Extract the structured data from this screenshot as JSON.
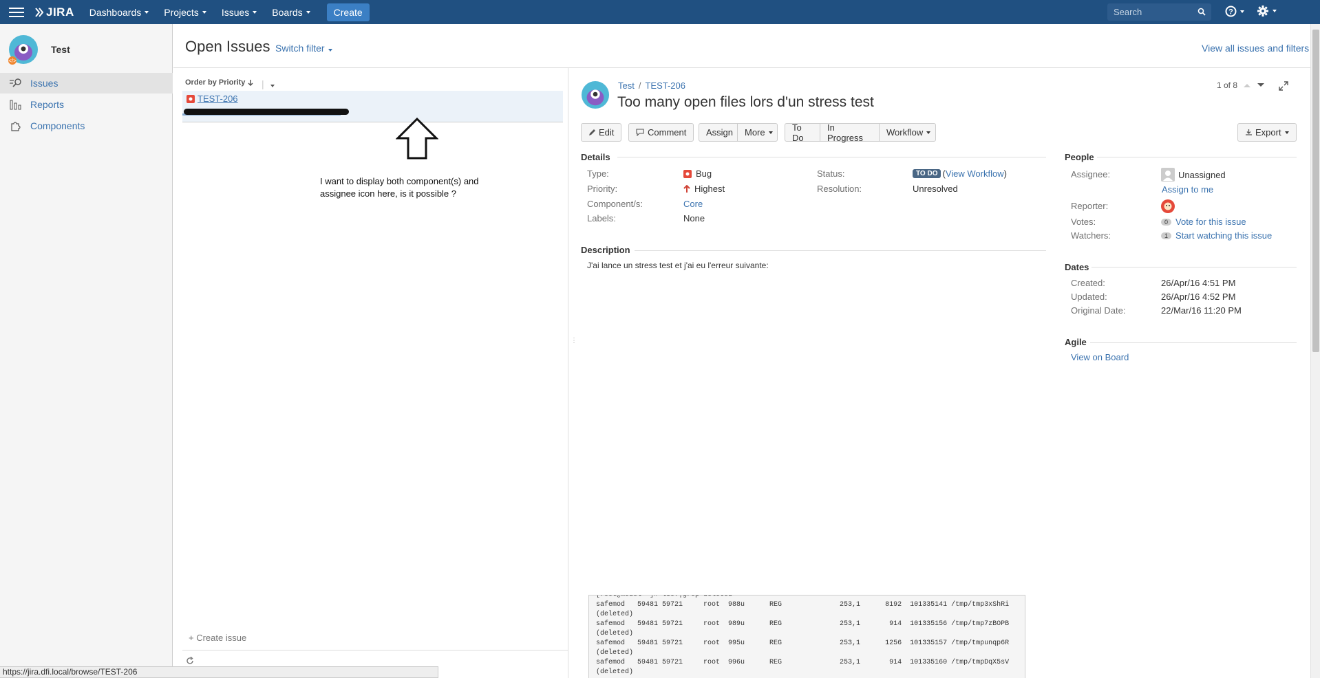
{
  "topnav": {
    "logo_text": "JIRA",
    "items": [
      "Dashboards",
      "Projects",
      "Issues",
      "Boards"
    ],
    "create_label": "Create",
    "search_placeholder": "Search",
    "brand_color": "#205081"
  },
  "sidebar": {
    "project_name": "Test",
    "items": [
      {
        "label": "Issues",
        "icon": "issues-search-icon"
      },
      {
        "label": "Reports",
        "icon": "reports-chart-icon"
      },
      {
        "label": "Components",
        "icon": "components-puzzle-icon"
      }
    ]
  },
  "header": {
    "title": "Open Issues",
    "switch_filter": "Switch filter",
    "view_all": "View all issues and filters"
  },
  "list": {
    "order_by": "Order by Priority",
    "issue_key": "TEST-206",
    "create_issue": "+ Create issue",
    "annotation_line1": "I want to display both component(s) and",
    "annotation_line2": "assignee icon here, is it possible ?"
  },
  "status_url": "https://jira.dfi.local/browse/TEST-206",
  "detail": {
    "crumb_project": "Test",
    "crumb_sep": "/",
    "crumb_key": "TEST-206",
    "title": "Too many open files lors d'un stress test",
    "pager": "1 of 8",
    "buttons": {
      "edit": "Edit",
      "comment": "Comment",
      "assign": "Assign",
      "more": "More",
      "todo": "To Do",
      "in_progress": "In Progress",
      "workflow": "Workflow",
      "export": "Export"
    },
    "details": {
      "title": "Details",
      "type_label": "Type:",
      "type_value": "Bug",
      "priority_label": "Priority:",
      "priority_value": "Highest",
      "component_label": "Component/s:",
      "component_value": "Core",
      "labels_label": "Labels:",
      "labels_value": "None",
      "status_label": "Status:",
      "status_value": "TO DO",
      "view_workflow": "View Workflow",
      "resolution_label": "Resolution:",
      "resolution_value": "Unresolved"
    },
    "description": {
      "title": "Description",
      "text": "J'ai lance un stress test et j'ai eu l'erreur suivante:"
    },
    "people": {
      "title": "People",
      "assignee_label": "Assignee:",
      "assignee_value": "Unassigned",
      "assign_to_me": "Assign to me",
      "reporter_label": "Reporter:",
      "votes_label": "Votes:",
      "votes_count": "0",
      "vote_link": "Vote for this issue",
      "watchers_label": "Watchers:",
      "watchers_count": "1",
      "watch_link": "Start watching this issue"
    },
    "dates": {
      "title": "Dates",
      "created_label": "Created:",
      "created_value": "26/Apr/16 4:51 PM",
      "updated_label": "Updated:",
      "updated_value": "26/Apr/16 4:52 PM",
      "original_label": "Original Date:",
      "original_value": "22/Mar/16 11:20 PM"
    },
    "agile": {
      "title": "Agile",
      "link": "View on Board"
    },
    "code_lines": [
      "[root@model ~]# lsof|grep deleted",
      "safemod   59481 59721     root  988u      REG              253,1      8192  101335141 /tmp/tmp3xShRi",
      "(deleted)",
      "safemod   59481 59721     root  989u      REG              253,1       914  101335156 /tmp/tmp7zBOPB",
      "(deleted)",
      "safemod   59481 59721     root  995u      REG              253,1      1256  101335157 /tmp/tmpunqp6R",
      "(deleted)",
      "safemod   59481 59721     root  996u      REG              253,1       914  101335160 /tmp/tmpDqX5sV",
      "(deleted)"
    ]
  }
}
